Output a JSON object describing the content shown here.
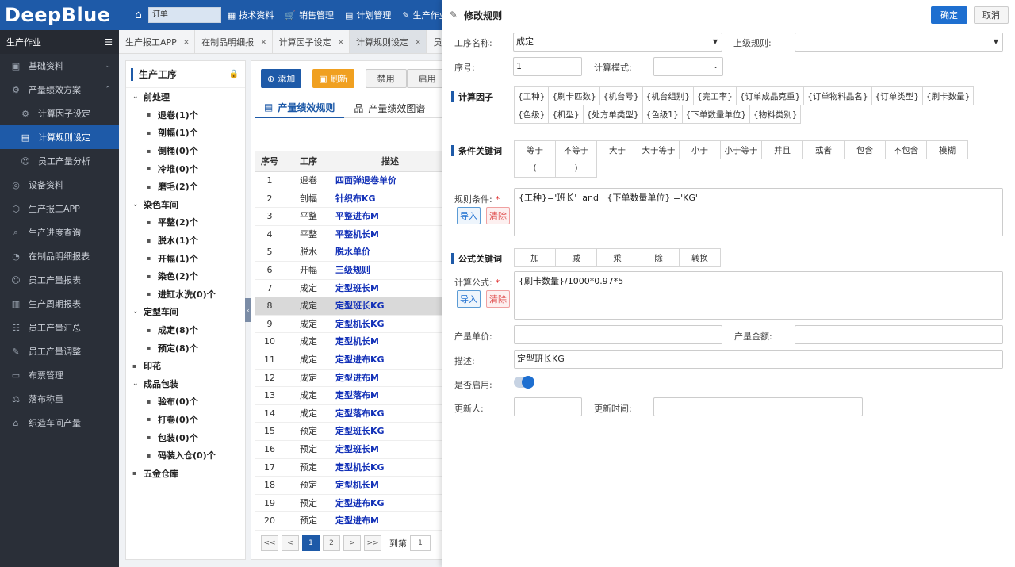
{
  "app": {
    "logo": "DeepBlue"
  },
  "topbar": {
    "search_value": "订单",
    "nav": [
      {
        "icon": "grid-icon",
        "label": "技术资料"
      },
      {
        "icon": "cart-icon",
        "label": "销售管理"
      },
      {
        "icon": "calendar-icon",
        "label": "计划管理"
      },
      {
        "icon": "tools-icon",
        "label": "生产作业"
      }
    ]
  },
  "sidebar": {
    "header": "生产作业",
    "items": [
      {
        "label": "基础资料",
        "icon": "box-icon"
      },
      {
        "label": "产量绩效方案",
        "icon": "gear-icon"
      },
      {
        "label": "计算因子设定",
        "icon": "cog-icon"
      },
      {
        "label": "计算规则设定",
        "icon": "doc-icon"
      },
      {
        "label": "员工产量分析",
        "icon": "user-icon"
      },
      {
        "label": "设备资料",
        "icon": "device-icon"
      },
      {
        "label": "生产报工APP",
        "icon": "cube-icon"
      },
      {
        "label": "生产进度查询",
        "icon": "search-icon"
      },
      {
        "label": "在制品明细报表",
        "icon": "chart-icon"
      },
      {
        "label": "员工产量报表",
        "icon": "user-icon"
      },
      {
        "label": "生产周期报表",
        "icon": "bar-chart-icon"
      },
      {
        "label": "员工产量汇总",
        "icon": "sum-icon"
      },
      {
        "label": "员工产量调整",
        "icon": "edit-icon"
      },
      {
        "label": "布票管理",
        "icon": "ticket-icon"
      },
      {
        "label": "落布称重",
        "icon": "scale-icon"
      },
      {
        "label": "织造车间产量",
        "icon": "factory-icon"
      }
    ]
  },
  "tabs": [
    {
      "label": "生产报工APP"
    },
    {
      "label": "在制品明细报"
    },
    {
      "label": "计算因子设定"
    },
    {
      "label": "计算规则设定"
    },
    {
      "label": "员工产量"
    }
  ],
  "tree": {
    "title": "生产工序",
    "nodes": [
      {
        "label": "前处理",
        "level": 0
      },
      {
        "label": "退卷(1)个",
        "level": 1
      },
      {
        "label": "剖幅(1)个",
        "level": 1
      },
      {
        "label": "倒桶(0)个",
        "level": 1
      },
      {
        "label": "冷堆(0)个",
        "level": 1
      },
      {
        "label": "磨毛(2)个",
        "level": 1
      },
      {
        "label": "染色车间",
        "level": 0
      },
      {
        "label": "平整(2)个",
        "level": 1
      },
      {
        "label": "脱水(1)个",
        "level": 1
      },
      {
        "label": "开幅(1)个",
        "level": 1
      },
      {
        "label": "染色(2)个",
        "level": 1
      },
      {
        "label": "进缸水洗(0)个",
        "level": 1
      },
      {
        "label": "定型车间",
        "level": 0
      },
      {
        "label": "成定(8)个",
        "level": 1
      },
      {
        "label": "预定(8)个",
        "level": 1
      },
      {
        "label": "印花",
        "level": 0
      },
      {
        "label": "成品包装",
        "level": 0
      },
      {
        "label": "验布(0)个",
        "level": 1
      },
      {
        "label": "打卷(0)个",
        "level": 1
      },
      {
        "label": "包装(0)个",
        "level": 1
      },
      {
        "label": "码装入仓(0)个",
        "level": 1
      },
      {
        "label": "五金仓库",
        "level": 0
      }
    ]
  },
  "main": {
    "buttons": {
      "add": "添加",
      "refresh": "刷新",
      "disable": "禁用",
      "enable": "启用"
    },
    "subtabs": [
      "产量绩效规则",
      "产量绩效图谱"
    ],
    "columns": {
      "no": "序号",
      "process": "工序",
      "desc": "描述"
    },
    "rows": [
      {
        "no": "1",
        "process": "退卷",
        "desc": "四面弹退卷单价"
      },
      {
        "no": "2",
        "process": "剖幅",
        "desc": "针织布KG"
      },
      {
        "no": "3",
        "process": "平整",
        "desc": "平整进布M"
      },
      {
        "no": "4",
        "process": "平整",
        "desc": "平整机长M"
      },
      {
        "no": "5",
        "process": "脱水",
        "desc": "脱水单价"
      },
      {
        "no": "6",
        "process": "开幅",
        "desc": "三级规则"
      },
      {
        "no": "7",
        "process": "成定",
        "desc": "定型班长M"
      },
      {
        "no": "8",
        "process": "成定",
        "desc": "定型班长KG"
      },
      {
        "no": "9",
        "process": "成定",
        "desc": "定型机长KG"
      },
      {
        "no": "10",
        "process": "成定",
        "desc": "定型机长M"
      },
      {
        "no": "11",
        "process": "成定",
        "desc": "定型进布KG"
      },
      {
        "no": "12",
        "process": "成定",
        "desc": "定型进布M"
      },
      {
        "no": "13",
        "process": "成定",
        "desc": "定型落布M"
      },
      {
        "no": "14",
        "process": "成定",
        "desc": "定型落布KG"
      },
      {
        "no": "15",
        "process": "预定",
        "desc": "定型班长KG"
      },
      {
        "no": "16",
        "process": "预定",
        "desc": "定型班长M"
      },
      {
        "no": "17",
        "process": "预定",
        "desc": "定型机长KG"
      },
      {
        "no": "18",
        "process": "预定",
        "desc": "定型机长M"
      },
      {
        "no": "19",
        "process": "预定",
        "desc": "定型进布KG"
      },
      {
        "no": "20",
        "process": "预定",
        "desc": "定型进布M"
      }
    ],
    "selected_row": "8",
    "pager": {
      "first": "<<",
      "prev": "<",
      "page1": "1",
      "page2": "2",
      "next": ">",
      "last": ">>",
      "goto_label": "到第",
      "goto_value": "1"
    }
  },
  "dialog": {
    "title": "修改规则",
    "ok": "确定",
    "cancel": "取消",
    "labels": {
      "process_name": "工序名称:",
      "parent_rule": "上级规则:",
      "seq": "序号:",
      "calc_mode": "计算模式:",
      "rule_condition": "规则条件:",
      "formula": "计算公式:",
      "unit_price": "产量单价:",
      "amount": "产量金额:",
      "desc": "描述:",
      "enabled": "是否启用:",
      "updater": "更新人:",
      "update_time": "更新时间:"
    },
    "values": {
      "process_name": "成定",
      "parent_rule": "",
      "seq": "1",
      "calc_mode": "",
      "rule_condition": "{工种}='班长'  and   {下单数量单位} ='KG'",
      "formula": "{刷卡数量}/1000*0.97*5",
      "unit_price": "",
      "amount": "",
      "desc": "定型班长KG",
      "updater": "",
      "update_time": ""
    },
    "enabled": true,
    "sections": {
      "factors": "计算因子",
      "conditions": "条件关键词",
      "formula_kw": "公式关键词"
    },
    "factors": [
      "{工种}",
      "{刷卡匹数}",
      "{机台号}",
      "{机台组别}",
      "{完工率}",
      "{订单成品克重}",
      "{订单物料品名}",
      "{订单类型}",
      "{刷卡数量}",
      "{色级}",
      "{机型}",
      "{处方单类型}",
      "{色级1}",
      "{下单数量单位}",
      "{物料类别}"
    ],
    "condition_keywords": [
      "等于",
      "不等于",
      "大于",
      "大于等于",
      "小于",
      "小于等于",
      "并且",
      "或者",
      "包含",
      "不包含",
      "模糊",
      "(",
      ")"
    ],
    "formula_keywords": [
      "加",
      "减",
      "乘",
      "除",
      "转换"
    ],
    "import_label": "导入",
    "clear_label": "清除"
  }
}
